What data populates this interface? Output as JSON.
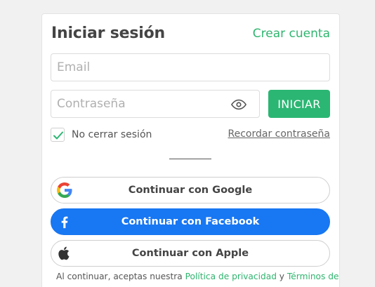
{
  "login": {
    "title": "Iniciar sesión",
    "create_account": "Crear cuenta",
    "email_placeholder": "Email",
    "password_placeholder": "Contraseña",
    "submit_label": "INICIAR",
    "remember_label": "No cerrar sesión",
    "remember_checked": true,
    "forgot_label": "Recordar contraseña"
  },
  "social": {
    "google_label": "Continuar con Google",
    "facebook_label": "Continuar con Facebook",
    "apple_label": "Continuar con Apple"
  },
  "terms": {
    "prefix": "Al continuar, aceptas nuestra ",
    "privacy_link": "Política de privacidad",
    "connector": " y ",
    "terms_link": "Términos de"
  },
  "icons": {
    "eye": "eye-icon",
    "check": "check-icon",
    "google": "google-icon",
    "facebook": "facebook-icon",
    "apple": "apple-icon"
  },
  "colors": {
    "accent": "#2bb673",
    "facebook": "#1877f2",
    "text": "#444444"
  }
}
